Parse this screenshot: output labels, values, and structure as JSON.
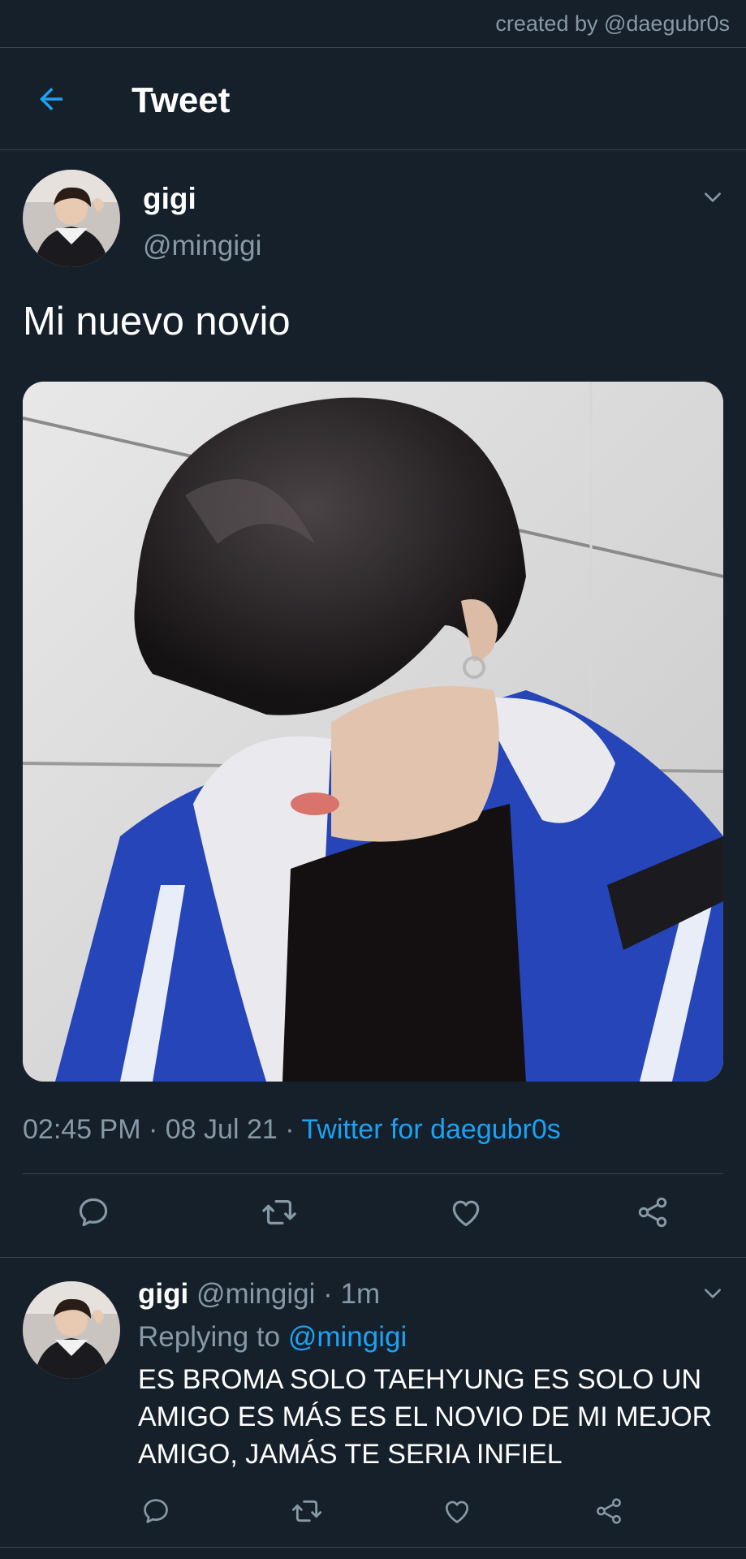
{
  "watermark": "created by @daegubr0s",
  "header": {
    "title": "Tweet",
    "back_icon": "arrow-left-icon"
  },
  "colors": {
    "background": "#15202b",
    "text_primary": "#ffffff",
    "text_secondary": "#8899a6",
    "accent": "#1da1f2",
    "divider": "#38444d"
  },
  "tweet": {
    "author_name": "gigi",
    "author_handle": "@mingigi",
    "text": "Mi nuevo novio",
    "time": "02:45 PM",
    "date": "08 Jul 21",
    "separator": "·",
    "source": "Twitter for daegubr0s",
    "actions": [
      "reply-icon",
      "retweet-icon",
      "like-icon",
      "share-icon"
    ]
  },
  "reply": {
    "author_name": "gigi",
    "author_handle": "@mingigi",
    "time_ago": "1m",
    "separator": "·",
    "replying_prefix": "Replying to",
    "replying_to": "@mingigi",
    "text": "ES BROMA SOLO TAEHYUNG ES SOLO UN AMIGO ES MÁS ES EL NOVIO DE MI MEJOR AMIGO, JAMÁS TE SERIA INFIEL",
    "actions": [
      "reply-icon",
      "retweet-icon",
      "like-icon",
      "share-icon"
    ]
  }
}
